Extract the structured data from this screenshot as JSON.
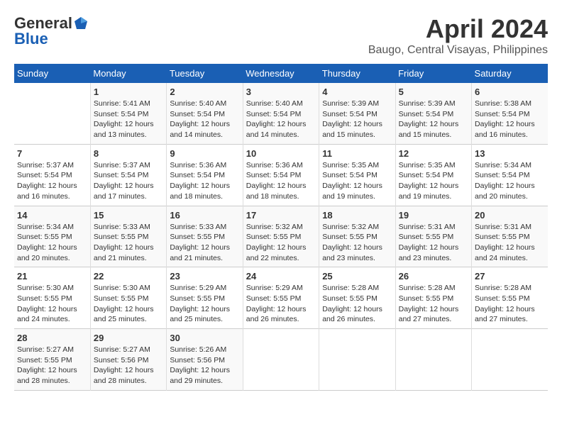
{
  "header": {
    "logo_general": "General",
    "logo_blue": "Blue",
    "month_title": "April 2024",
    "location": "Baugo, Central Visayas, Philippines"
  },
  "days_of_week": [
    "Sunday",
    "Monday",
    "Tuesday",
    "Wednesday",
    "Thursday",
    "Friday",
    "Saturday"
  ],
  "weeks": [
    [
      {
        "day": "",
        "sunrise": "",
        "sunset": "",
        "daylight": ""
      },
      {
        "day": "1",
        "sunrise": "Sunrise: 5:41 AM",
        "sunset": "Sunset: 5:54 PM",
        "daylight": "Daylight: 12 hours and 13 minutes."
      },
      {
        "day": "2",
        "sunrise": "Sunrise: 5:40 AM",
        "sunset": "Sunset: 5:54 PM",
        "daylight": "Daylight: 12 hours and 14 minutes."
      },
      {
        "day": "3",
        "sunrise": "Sunrise: 5:40 AM",
        "sunset": "Sunset: 5:54 PM",
        "daylight": "Daylight: 12 hours and 14 minutes."
      },
      {
        "day": "4",
        "sunrise": "Sunrise: 5:39 AM",
        "sunset": "Sunset: 5:54 PM",
        "daylight": "Daylight: 12 hours and 15 minutes."
      },
      {
        "day": "5",
        "sunrise": "Sunrise: 5:39 AM",
        "sunset": "Sunset: 5:54 PM",
        "daylight": "Daylight: 12 hours and 15 minutes."
      },
      {
        "day": "6",
        "sunrise": "Sunrise: 5:38 AM",
        "sunset": "Sunset: 5:54 PM",
        "daylight": "Daylight: 12 hours and 16 minutes."
      }
    ],
    [
      {
        "day": "7",
        "sunrise": "Sunrise: 5:37 AM",
        "sunset": "Sunset: 5:54 PM",
        "daylight": "Daylight: 12 hours and 16 minutes."
      },
      {
        "day": "8",
        "sunrise": "Sunrise: 5:37 AM",
        "sunset": "Sunset: 5:54 PM",
        "daylight": "Daylight: 12 hours and 17 minutes."
      },
      {
        "day": "9",
        "sunrise": "Sunrise: 5:36 AM",
        "sunset": "Sunset: 5:54 PM",
        "daylight": "Daylight: 12 hours and 18 minutes."
      },
      {
        "day": "10",
        "sunrise": "Sunrise: 5:36 AM",
        "sunset": "Sunset: 5:54 PM",
        "daylight": "Daylight: 12 hours and 18 minutes."
      },
      {
        "day": "11",
        "sunrise": "Sunrise: 5:35 AM",
        "sunset": "Sunset: 5:54 PM",
        "daylight": "Daylight: 12 hours and 19 minutes."
      },
      {
        "day": "12",
        "sunrise": "Sunrise: 5:35 AM",
        "sunset": "Sunset: 5:54 PM",
        "daylight": "Daylight: 12 hours and 19 minutes."
      },
      {
        "day": "13",
        "sunrise": "Sunrise: 5:34 AM",
        "sunset": "Sunset: 5:54 PM",
        "daylight": "Daylight: 12 hours and 20 minutes."
      }
    ],
    [
      {
        "day": "14",
        "sunrise": "Sunrise: 5:34 AM",
        "sunset": "Sunset: 5:55 PM",
        "daylight": "Daylight: 12 hours and 20 minutes."
      },
      {
        "day": "15",
        "sunrise": "Sunrise: 5:33 AM",
        "sunset": "Sunset: 5:55 PM",
        "daylight": "Daylight: 12 hours and 21 minutes."
      },
      {
        "day": "16",
        "sunrise": "Sunrise: 5:33 AM",
        "sunset": "Sunset: 5:55 PM",
        "daylight": "Daylight: 12 hours and 21 minutes."
      },
      {
        "day": "17",
        "sunrise": "Sunrise: 5:32 AM",
        "sunset": "Sunset: 5:55 PM",
        "daylight": "Daylight: 12 hours and 22 minutes."
      },
      {
        "day": "18",
        "sunrise": "Sunrise: 5:32 AM",
        "sunset": "Sunset: 5:55 PM",
        "daylight": "Daylight: 12 hours and 23 minutes."
      },
      {
        "day": "19",
        "sunrise": "Sunrise: 5:31 AM",
        "sunset": "Sunset: 5:55 PM",
        "daylight": "Daylight: 12 hours and 23 minutes."
      },
      {
        "day": "20",
        "sunrise": "Sunrise: 5:31 AM",
        "sunset": "Sunset: 5:55 PM",
        "daylight": "Daylight: 12 hours and 24 minutes."
      }
    ],
    [
      {
        "day": "21",
        "sunrise": "Sunrise: 5:30 AM",
        "sunset": "Sunset: 5:55 PM",
        "daylight": "Daylight: 12 hours and 24 minutes."
      },
      {
        "day": "22",
        "sunrise": "Sunrise: 5:30 AM",
        "sunset": "Sunset: 5:55 PM",
        "daylight": "Daylight: 12 hours and 25 minutes."
      },
      {
        "day": "23",
        "sunrise": "Sunrise: 5:29 AM",
        "sunset": "Sunset: 5:55 PM",
        "daylight": "Daylight: 12 hours and 25 minutes."
      },
      {
        "day": "24",
        "sunrise": "Sunrise: 5:29 AM",
        "sunset": "Sunset: 5:55 PM",
        "daylight": "Daylight: 12 hours and 26 minutes."
      },
      {
        "day": "25",
        "sunrise": "Sunrise: 5:28 AM",
        "sunset": "Sunset: 5:55 PM",
        "daylight": "Daylight: 12 hours and 26 minutes."
      },
      {
        "day": "26",
        "sunrise": "Sunrise: 5:28 AM",
        "sunset": "Sunset: 5:55 PM",
        "daylight": "Daylight: 12 hours and 27 minutes."
      },
      {
        "day": "27",
        "sunrise": "Sunrise: 5:28 AM",
        "sunset": "Sunset: 5:55 PM",
        "daylight": "Daylight: 12 hours and 27 minutes."
      }
    ],
    [
      {
        "day": "28",
        "sunrise": "Sunrise: 5:27 AM",
        "sunset": "Sunset: 5:55 PM",
        "daylight": "Daylight: 12 hours and 28 minutes."
      },
      {
        "day": "29",
        "sunrise": "Sunrise: 5:27 AM",
        "sunset": "Sunset: 5:56 PM",
        "daylight": "Daylight: 12 hours and 28 minutes."
      },
      {
        "day": "30",
        "sunrise": "Sunrise: 5:26 AM",
        "sunset": "Sunset: 5:56 PM",
        "daylight": "Daylight: 12 hours and 29 minutes."
      },
      {
        "day": "",
        "sunrise": "",
        "sunset": "",
        "daylight": ""
      },
      {
        "day": "",
        "sunrise": "",
        "sunset": "",
        "daylight": ""
      },
      {
        "day": "",
        "sunrise": "",
        "sunset": "",
        "daylight": ""
      },
      {
        "day": "",
        "sunrise": "",
        "sunset": "",
        "daylight": ""
      }
    ]
  ]
}
